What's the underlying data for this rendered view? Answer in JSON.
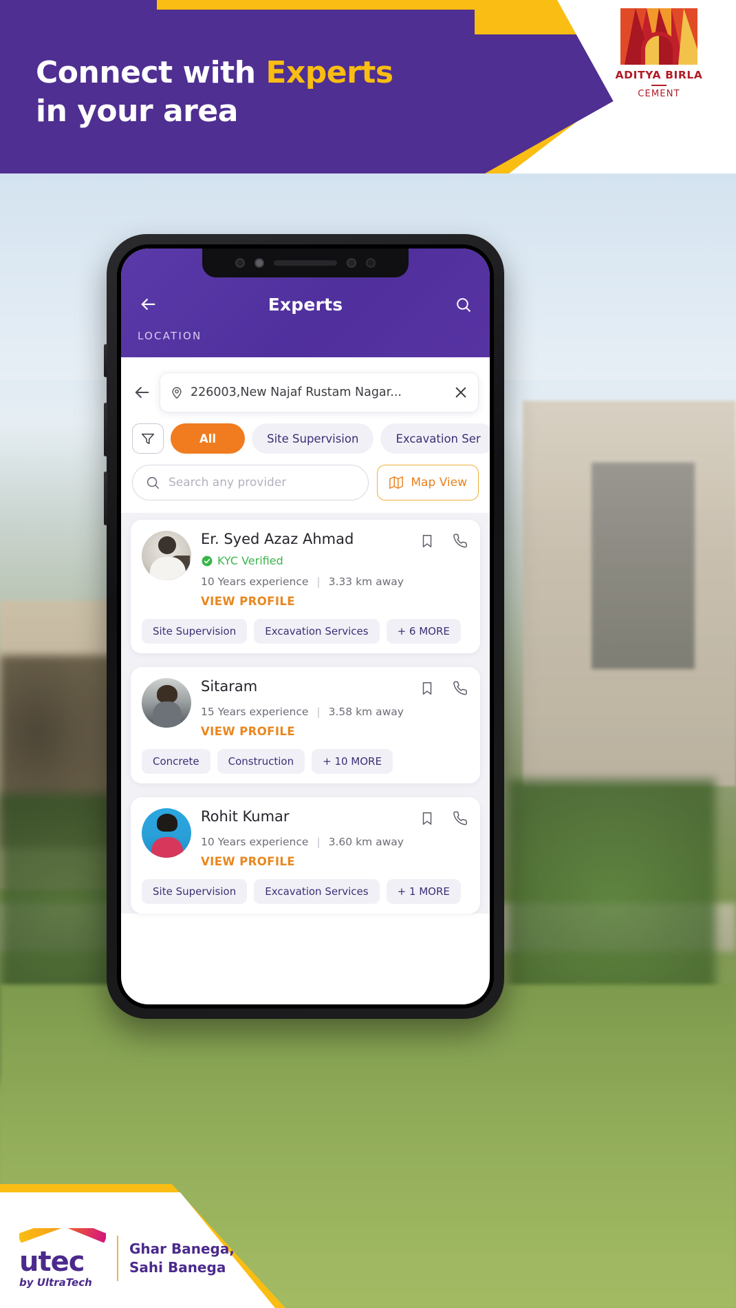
{
  "banner": {
    "headline_line1_prefix": "Connect with ",
    "headline_line1_accent": "Experts",
    "headline_line2": "in your area",
    "logo_name": "ADITYA BIRLA",
    "logo_sub": "CEMENT"
  },
  "app": {
    "header": {
      "back_icon": "arrow-left-icon",
      "title": "Experts",
      "search_icon": "search-icon",
      "location_label": "LOCATION"
    },
    "location_bar": {
      "back_icon": "arrow-left-icon",
      "pin_icon": "map-pin-icon",
      "value": "226003,New Najaf Rustam Nagar...",
      "clear_icon": "close-icon"
    },
    "filter_icon": "filter-icon",
    "chips": [
      {
        "label": "All",
        "active": true
      },
      {
        "label": "Site Supervision",
        "active": false
      },
      {
        "label": "Excavation Ser",
        "active": false
      }
    ],
    "search": {
      "icon": "search-icon",
      "placeholder": "Search any provider",
      "value": ""
    },
    "map_button": {
      "icon": "map-icon",
      "label": "Map View"
    },
    "experts": [
      {
        "name": "Er. Syed Azaz Ahmad",
        "kyc_badge": "KYC Verified",
        "kyc_verified": true,
        "experience": "10 Years experience",
        "separator": "|",
        "distance": "3.33 km away",
        "view_profile": "VIEW PROFILE",
        "bookmark_icon": "bookmark-icon",
        "call_icon": "phone-icon",
        "tags": [
          "Site Supervision",
          "Excavation Services",
          "+ 6 MORE"
        ]
      },
      {
        "name": "Sitaram",
        "kyc_badge": "",
        "kyc_verified": false,
        "experience": "15 Years experience",
        "separator": "|",
        "distance": "3.58 km away",
        "view_profile": "VIEW PROFILE",
        "bookmark_icon": "bookmark-icon",
        "call_icon": "phone-icon",
        "tags": [
          "Concrete",
          "Construction",
          "+ 10 MORE"
        ]
      },
      {
        "name": "Rohit Kumar",
        "kyc_badge": "",
        "kyc_verified": false,
        "experience": "10 Years experience",
        "separator": "|",
        "distance": "3.60 km away",
        "view_profile": "VIEW PROFILE",
        "bookmark_icon": "bookmark-icon",
        "call_icon": "phone-icon",
        "tags": [
          "Site Supervision",
          "Excavation Services",
          "+ 1 MORE"
        ]
      }
    ]
  },
  "footer": {
    "brand": "utec",
    "brand_by": "by UltraTech",
    "tagline_line1": "Ghar Banega,",
    "tagline_line2": "Sahi Banega"
  },
  "colors": {
    "purple": "#4f2f91",
    "yellow": "#f9bd13",
    "orange": "#f07c1f",
    "app_purple": "#50309d",
    "chip_bg": "#f2f0f7",
    "chip_text": "#3b2f74",
    "green": "#3bb54a",
    "profile_orange": "#e8871f",
    "brand_red": "#b01c26"
  }
}
